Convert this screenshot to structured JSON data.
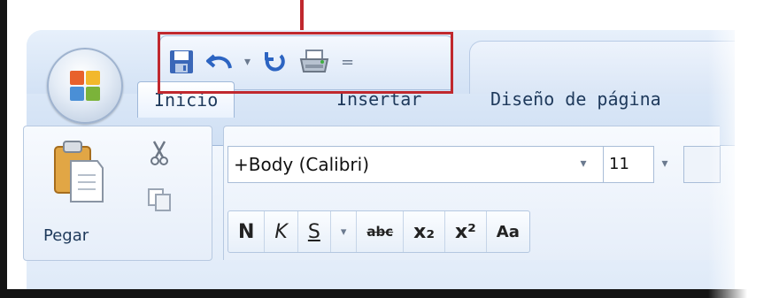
{
  "quick_access": {
    "icons": [
      "save-icon",
      "undo-icon",
      "undo-dropdown-icon",
      "redo-icon",
      "print-icon",
      "customize-qat-icon"
    ],
    "undo_arrow": "▾",
    "customize": "="
  },
  "tabs": [
    {
      "label": "Inicio",
      "active": true
    },
    {
      "label": "Insertar",
      "active": false
    },
    {
      "label": "Diseño de página",
      "active": false
    }
  ],
  "clipboard": {
    "paste_label": "Pegar"
  },
  "font": {
    "name": "+Body (Calibri)",
    "size": "11",
    "dropdown_arrow": "▾"
  },
  "format_buttons": {
    "bold": "N",
    "italic": "K",
    "underline": "S",
    "underline_arrow": "▾",
    "strikethrough": "abc",
    "subscript": "x₂",
    "superscript": "x²",
    "change_case": "Aa"
  },
  "colors": {
    "highlight": "#c0282e",
    "tab_text": "#1e395b",
    "ribbon": "#dfeaf8"
  }
}
